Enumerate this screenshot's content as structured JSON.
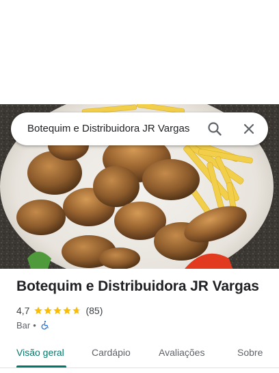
{
  "search": {
    "query": "Botequim e Distribuidora JR Vargas"
  },
  "place": {
    "name": "Botequim e Distribuidora JR Vargas",
    "rating": "4,7",
    "rating_value": 4.7,
    "stars_max": 5,
    "review_count": "(85)",
    "category": "Bar",
    "separator": "•"
  },
  "tabs": [
    {
      "label": "Visão geral",
      "active": true
    },
    {
      "label": "Cardápio",
      "active": false
    },
    {
      "label": "Avaliações",
      "active": false
    },
    {
      "label": "Sobre",
      "active": false
    }
  ],
  "colors": {
    "accent": "#00796b",
    "star": "#fbbc04",
    "accessibility": "#1a73e8"
  },
  "hero_photo": "fried chicken pieces with french fries and tomato on a white plate"
}
